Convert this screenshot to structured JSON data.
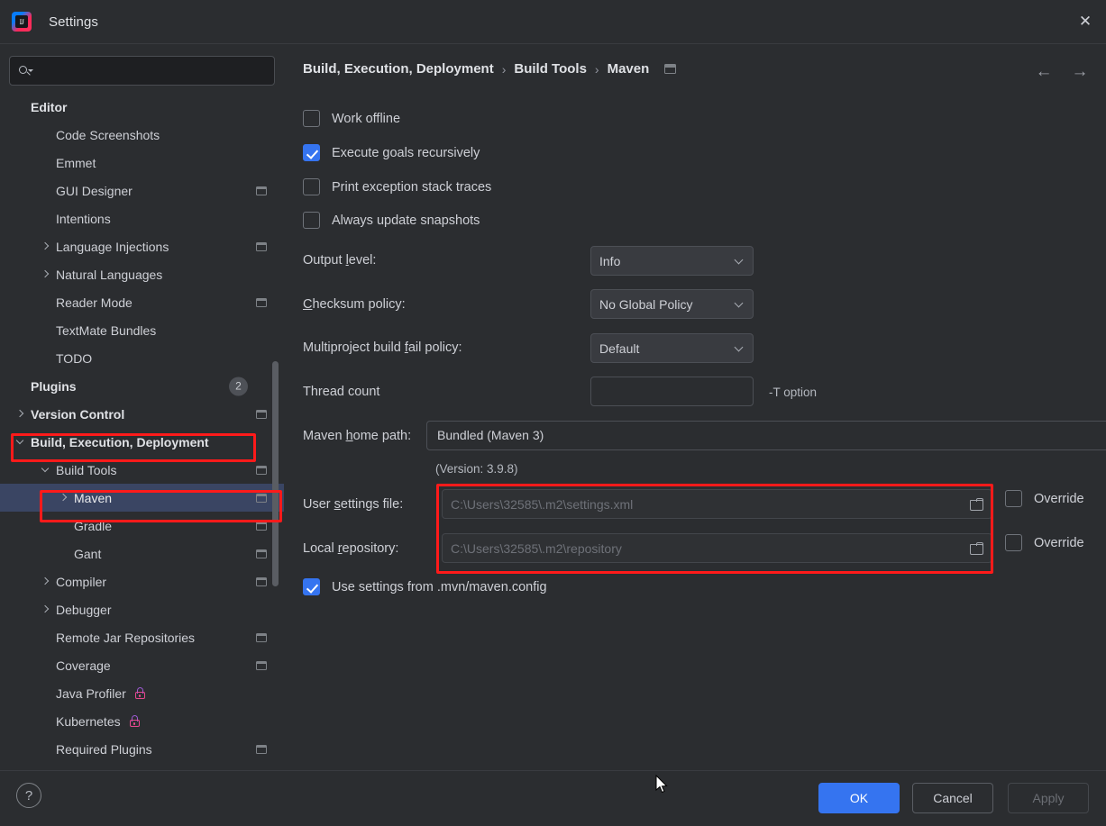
{
  "window": {
    "title": "Settings",
    "logo_text": "IJ",
    "close_icon": "✕"
  },
  "sidebar": {
    "search": {
      "placeholder": "",
      "value": ""
    },
    "items": [
      {
        "label": "Editor",
        "indent": 0,
        "bold": true,
        "arrow": "none",
        "proj": false
      },
      {
        "label": "Code Screenshots",
        "indent": 1,
        "bold": false,
        "arrow": "none",
        "proj": false
      },
      {
        "label": "Emmet",
        "indent": 1,
        "bold": false,
        "arrow": "none",
        "proj": false
      },
      {
        "label": "GUI Designer",
        "indent": 1,
        "bold": false,
        "arrow": "none",
        "proj": true
      },
      {
        "label": "Intentions",
        "indent": 1,
        "bold": false,
        "arrow": "none",
        "proj": false
      },
      {
        "label": "Language Injections",
        "indent": 1,
        "bold": false,
        "arrow": "right",
        "proj": true
      },
      {
        "label": "Natural Languages",
        "indent": 1,
        "bold": false,
        "arrow": "right",
        "proj": false
      },
      {
        "label": "Reader Mode",
        "indent": 1,
        "bold": false,
        "arrow": "none",
        "proj": true
      },
      {
        "label": "TextMate Bundles",
        "indent": 1,
        "bold": false,
        "arrow": "none",
        "proj": false
      },
      {
        "label": "TODO",
        "indent": 1,
        "bold": false,
        "arrow": "none",
        "proj": false
      },
      {
        "label": "Plugins",
        "indent": 0,
        "bold": true,
        "arrow": "none",
        "proj": false,
        "badge": "2"
      },
      {
        "label": "Version Control",
        "indent": 0,
        "bold": true,
        "arrow": "right",
        "proj": true
      },
      {
        "label": "Build, Execution, Deployment",
        "indent": 0,
        "bold": true,
        "arrow": "down",
        "proj": false,
        "highlight": true
      },
      {
        "label": "Build Tools",
        "indent": 1,
        "bold": false,
        "arrow": "down",
        "proj": true
      },
      {
        "label": "Maven",
        "indent": 2,
        "bold": false,
        "arrow": "right",
        "proj": true,
        "selected": true,
        "highlight": true
      },
      {
        "label": "Gradle",
        "indent": 2,
        "bold": false,
        "arrow": "none",
        "proj": true
      },
      {
        "label": "Gant",
        "indent": 2,
        "bold": false,
        "arrow": "none",
        "proj": true
      },
      {
        "label": "Compiler",
        "indent": 1,
        "bold": false,
        "arrow": "right",
        "proj": true
      },
      {
        "label": "Debugger",
        "indent": 1,
        "bold": false,
        "arrow": "right",
        "proj": false
      },
      {
        "label": "Remote Jar Repositories",
        "indent": 1,
        "bold": false,
        "arrow": "none",
        "proj": true
      },
      {
        "label": "Coverage",
        "indent": 1,
        "bold": false,
        "arrow": "none",
        "proj": true
      },
      {
        "label": "Java Profiler",
        "indent": 1,
        "bold": false,
        "arrow": "none",
        "proj": false,
        "lock": true
      },
      {
        "label": "Kubernetes",
        "indent": 1,
        "bold": false,
        "arrow": "none",
        "proj": false,
        "lock": true
      },
      {
        "label": "Required Plugins",
        "indent": 1,
        "bold": false,
        "arrow": "none",
        "proj": true
      }
    ]
  },
  "breadcrumb": {
    "crumb1": "Build, Execution, Deployment",
    "sep1": "›",
    "crumb2": "Build Tools",
    "sep2": "›",
    "crumb3": "Maven",
    "back_icon": "←",
    "forward_icon": "→"
  },
  "main": {
    "checkboxes": [
      {
        "label": "Work offline",
        "checked": false
      },
      {
        "label": "Execute goals recursively",
        "checked": true
      },
      {
        "label": "Print exception stack traces",
        "checked": false
      },
      {
        "label": "Always update snapshots",
        "checked": false
      }
    ],
    "output_level": {
      "label_a": "Output ",
      "label_u": "l",
      "label_b": "evel:",
      "value": "Info"
    },
    "checksum_policy": {
      "label_a": "",
      "label_u": "C",
      "label_b": "hecksum policy:",
      "value": "No Global Policy"
    },
    "multiproject_policy": {
      "label_a": "Multiproject build ",
      "label_u": "f",
      "label_b": "ail policy:",
      "value": "Default"
    },
    "thread_count": {
      "label": "Thread count",
      "value": "",
      "placeholder": "",
      "hint": "-T option"
    },
    "maven_home": {
      "label_a": "Maven ",
      "label_u": "h",
      "label_b": "ome path:",
      "value": "Bundled (Maven 3)",
      "ellipsis": "…",
      "version": "(Version: 3.9.8)"
    },
    "user_settings": {
      "label_a": "User ",
      "label_u": "s",
      "label_b": "ettings file:",
      "placeholder": "C:\\Users\\32585\\.m2\\settings.xml",
      "value": "",
      "override_label": "Override",
      "override_checked": false
    },
    "local_repository": {
      "label_a": "Local ",
      "label_u": "r",
      "label_b": "epository:",
      "placeholder": "C:\\Users\\32585\\.m2\\repository",
      "value": "",
      "override_label": "Override",
      "override_checked": false
    },
    "use_mvn_config": {
      "label": "Use settings from .mvn/maven.config",
      "checked": true
    }
  },
  "footer": {
    "help_icon": "?",
    "ok": "OK",
    "cancel": "Cancel",
    "apply": "Apply"
  },
  "colors": {
    "accent_blue": "#3574F0",
    "annotation_red": "#FF1A1A",
    "selection_blue": "#3A4563",
    "background": "#2B2D30"
  }
}
